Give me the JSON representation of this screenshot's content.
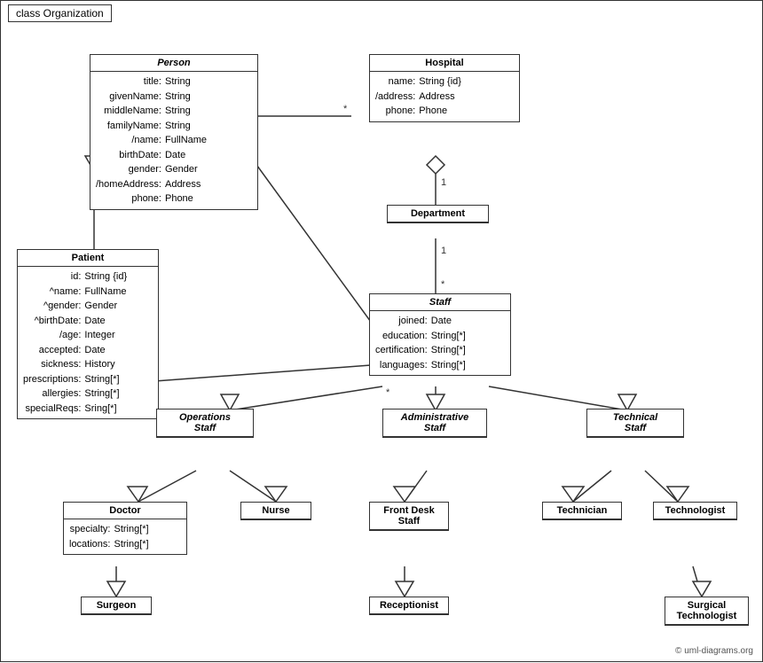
{
  "title": "class Organization",
  "classes": {
    "person": {
      "name": "Person",
      "attributes": [
        [
          "title:",
          "String"
        ],
        [
          "givenName:",
          "String"
        ],
        [
          "middleName:",
          "String"
        ],
        [
          "familyName:",
          "String"
        ],
        [
          "/name:",
          "FullName"
        ],
        [
          "birthDate:",
          "Date"
        ],
        [
          "gender:",
          "Gender"
        ],
        [
          "/homeAddress:",
          "Address"
        ],
        [
          "phone:",
          "Phone"
        ]
      ]
    },
    "hospital": {
      "name": "Hospital",
      "attributes": [
        [
          "name:",
          "String {id}"
        ],
        [
          "/address:",
          "Address"
        ],
        [
          "phone:",
          "Phone"
        ]
      ]
    },
    "patient": {
      "name": "Patient",
      "attributes": [
        [
          "id:",
          "String {id}"
        ],
        [
          "^name:",
          "FullName"
        ],
        [
          "^gender:",
          "Gender"
        ],
        [
          "^birthDate:",
          "Date"
        ],
        [
          "/age:",
          "Integer"
        ],
        [
          "accepted:",
          "Date"
        ],
        [
          "sickness:",
          "History"
        ],
        [
          "prescriptions:",
          "String[*]"
        ],
        [
          "allergies:",
          "String[*]"
        ],
        [
          "specialReqs:",
          "Sring[*]"
        ]
      ]
    },
    "department": {
      "name": "Department"
    },
    "staff": {
      "name": "Staff",
      "attributes": [
        [
          "joined:",
          "Date"
        ],
        [
          "education:",
          "String[*]"
        ],
        [
          "certification:",
          "String[*]"
        ],
        [
          "languages:",
          "String[*]"
        ]
      ]
    },
    "operations_staff": {
      "name": "Operations\nStaff"
    },
    "administrative_staff": {
      "name": "Administrative\nStaff"
    },
    "technical_staff": {
      "name": "Technical\nStaff"
    },
    "doctor": {
      "name": "Doctor",
      "attributes": [
        [
          "specialty:",
          "String[*]"
        ],
        [
          "locations:",
          "String[*]"
        ]
      ]
    },
    "nurse": {
      "name": "Nurse"
    },
    "front_desk_staff": {
      "name": "Front Desk\nStaff"
    },
    "technician": {
      "name": "Technician"
    },
    "technologist": {
      "name": "Technologist"
    },
    "surgeon": {
      "name": "Surgeon"
    },
    "receptionist": {
      "name": "Receptionist"
    },
    "surgical_technologist": {
      "name": "Surgical\nTechnologist"
    }
  },
  "copyright": "© uml-diagrams.org"
}
